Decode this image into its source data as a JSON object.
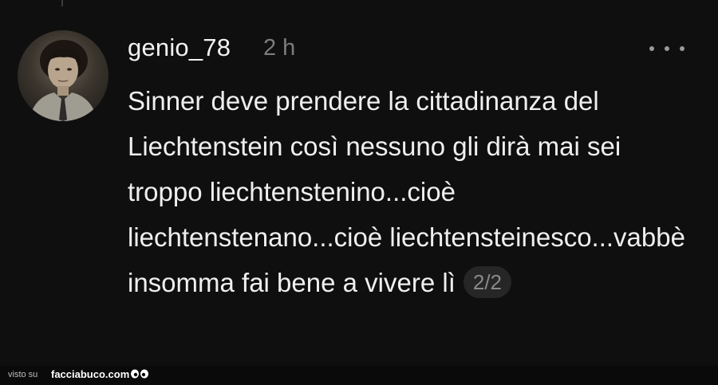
{
  "comment": {
    "username": "genio_78",
    "time": "2 h",
    "text": "Sinner deve prendere la cittadinanza del Liechtenstein così nessuno gli dirà mai sei troppo liechtenstenino...cioè liechtenstenano...cioè liechtensteinesco...vabbè insomma fai bene a vivere lì",
    "page_indicator": "2/2"
  },
  "watermark": {
    "prefix": "visto su",
    "site": "facciabuco.com"
  },
  "icons": {
    "more": "more-options-icon",
    "avatar": "user-avatar",
    "eyes": "eyes-logo-icon"
  }
}
